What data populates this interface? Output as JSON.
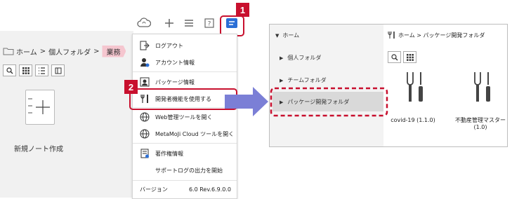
{
  "breadcrumb": {
    "home": "ホーム",
    "sep": ">",
    "personal": "個人フォルダ",
    "current": "業務"
  },
  "new_note": {
    "label": "新規ノート作成"
  },
  "toolbar": {
    "icons": [
      "cloud-sync-icon",
      "plus-icon",
      "hamburger-menu-icon",
      "help-icon",
      "developer-menu-icon"
    ]
  },
  "menu": {
    "items": [
      {
        "label": "ログアウト",
        "icon": "logout-icon"
      },
      {
        "label": "アカウント情報",
        "icon": "account-icon"
      },
      {
        "label": "パッケージ情報",
        "icon": "package-info-icon"
      },
      {
        "label": "開発者機能を使用する",
        "icon": "developer-tools-icon"
      },
      {
        "label": "Web管理ツールを開く",
        "icon": "globe-icon"
      },
      {
        "label": "MetaMoJi Cloud ツールを開く",
        "icon": "cloud-globe-icon"
      },
      {
        "label": "著作権情報",
        "icon": "copyright-icon"
      },
      {
        "label": "サポートログの出力を開始",
        "icon": ""
      }
    ],
    "version_label": "バージョン",
    "version_value": "6.0 Rev.6.9.0.0"
  },
  "callouts": {
    "one": "1",
    "two": "2"
  },
  "right_panel": {
    "sidebar": {
      "home": "ホーム",
      "items": [
        "個人フォルダ",
        "チームフォルダ",
        "パッケージ開発フォルダ"
      ]
    },
    "breadcrumb": "ホーム > パッケージ開発フォルダ",
    "packages": [
      {
        "name": "covid-19 (1.1.0)"
      },
      {
        "name": "不動産管理マスター (1.0)"
      }
    ]
  },
  "colors": {
    "accent_red": "#c8102e",
    "arrow": "#7b7fd6",
    "highlight_pink": "#f5c6cf",
    "app_blue": "#2b6fd6"
  }
}
